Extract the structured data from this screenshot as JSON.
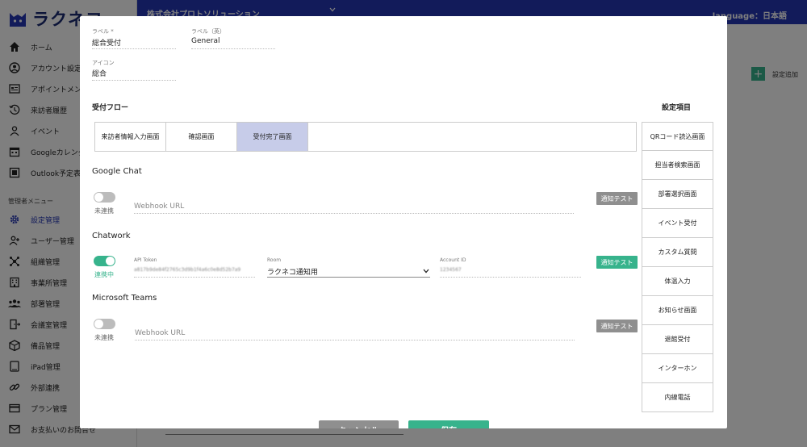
{
  "app": {
    "logo_text": "ラクネコ"
  },
  "topbar": {
    "company": "株式会社プロトソリューション",
    "language": "language：日本語"
  },
  "sidebar": {
    "items": [
      {
        "label": "ホーム",
        "icon": "home-icon"
      },
      {
        "label": "アカウント設定",
        "icon": "account-circle-icon"
      },
      {
        "label": "アポイントメント",
        "icon": "appointment-card-icon"
      },
      {
        "label": "来訪者履歴",
        "icon": "history-icon"
      },
      {
        "label": "イベント",
        "icon": "person-icon"
      },
      {
        "label": "Googleカレンダー",
        "icon": "calendar-icon"
      },
      {
        "label": "Outlook予定表",
        "icon": "outlook-icon"
      }
    ],
    "admin_section": "管理者メニュー",
    "admin_items": [
      {
        "label": "設定管理",
        "icon": "gear-icon",
        "active": true
      },
      {
        "label": "ユーザー管理",
        "icon": "user-add-icon"
      },
      {
        "label": "組織管理",
        "icon": "organization-icon"
      },
      {
        "label": "事業所管理",
        "icon": "building-icon"
      },
      {
        "label": "部署管理",
        "icon": "group-icon"
      },
      {
        "label": "会議室管理",
        "icon": "door-icon"
      },
      {
        "label": "備品管理",
        "icon": "box-icon"
      },
      {
        "label": "iPad管理",
        "icon": "tablet-icon"
      },
      {
        "label": "外部連携",
        "icon": "link-icon"
      },
      {
        "label": "プラン管理",
        "icon": "credit-card-icon"
      },
      {
        "label": "お支払いのお問合せ",
        "icon": "mail-icon"
      }
    ]
  },
  "background": {
    "add_setting": "設定追加"
  },
  "modal": {
    "label_jp": {
      "label": "ラベル *",
      "value": "総合受付"
    },
    "label_en": {
      "label": "ラベル（英）",
      "value": "General"
    },
    "icon_field": {
      "label": "アイコン",
      "value": "総合"
    },
    "flow_heading": "受付フロー",
    "flow_tabs": [
      {
        "label": "来訪者情報入力画面",
        "selected": false
      },
      {
        "label": "確認画面",
        "selected": false
      },
      {
        "label": "受付完了画面",
        "selected": true
      }
    ],
    "google_chat": {
      "title": "Google Chat",
      "status": "未連携",
      "enabled": false,
      "webhook_placeholder": "Webhook URL",
      "test_button": "通知テスト"
    },
    "chatwork": {
      "title": "Chatwork",
      "status": "連携中",
      "enabled": true,
      "api_token_label": "API Token",
      "api_token_value": "a817b9de84f2765c3d9b1f4a6c0e8d52b7a9",
      "room_label": "Room",
      "room_value": "ラクネコ通知用",
      "account_id_label": "Account ID",
      "account_id_value": "1234567",
      "test_button": "通知テスト"
    },
    "teams": {
      "title": "Microsoft Teams",
      "status": "未連携",
      "enabled": false,
      "webhook_placeholder": "Webhook URL",
      "test_button": "通知テスト"
    },
    "settings_heading": "設定項目",
    "settings_items": [
      "QRコード読込画面",
      "担当者検索画面",
      "部署選択画面",
      "イベント受付",
      "カスタム質問",
      "体温入力",
      "お知らせ画面",
      "退館受付",
      "インターホン",
      "内線電話"
    ],
    "cancel_button": "キャンセル",
    "save_button": "保存"
  },
  "colors": {
    "brand_blue": "#2436b5",
    "accent_green": "#37b38c",
    "tab_selected": "#c7cce9",
    "button_gray": "#8f8f8f"
  }
}
